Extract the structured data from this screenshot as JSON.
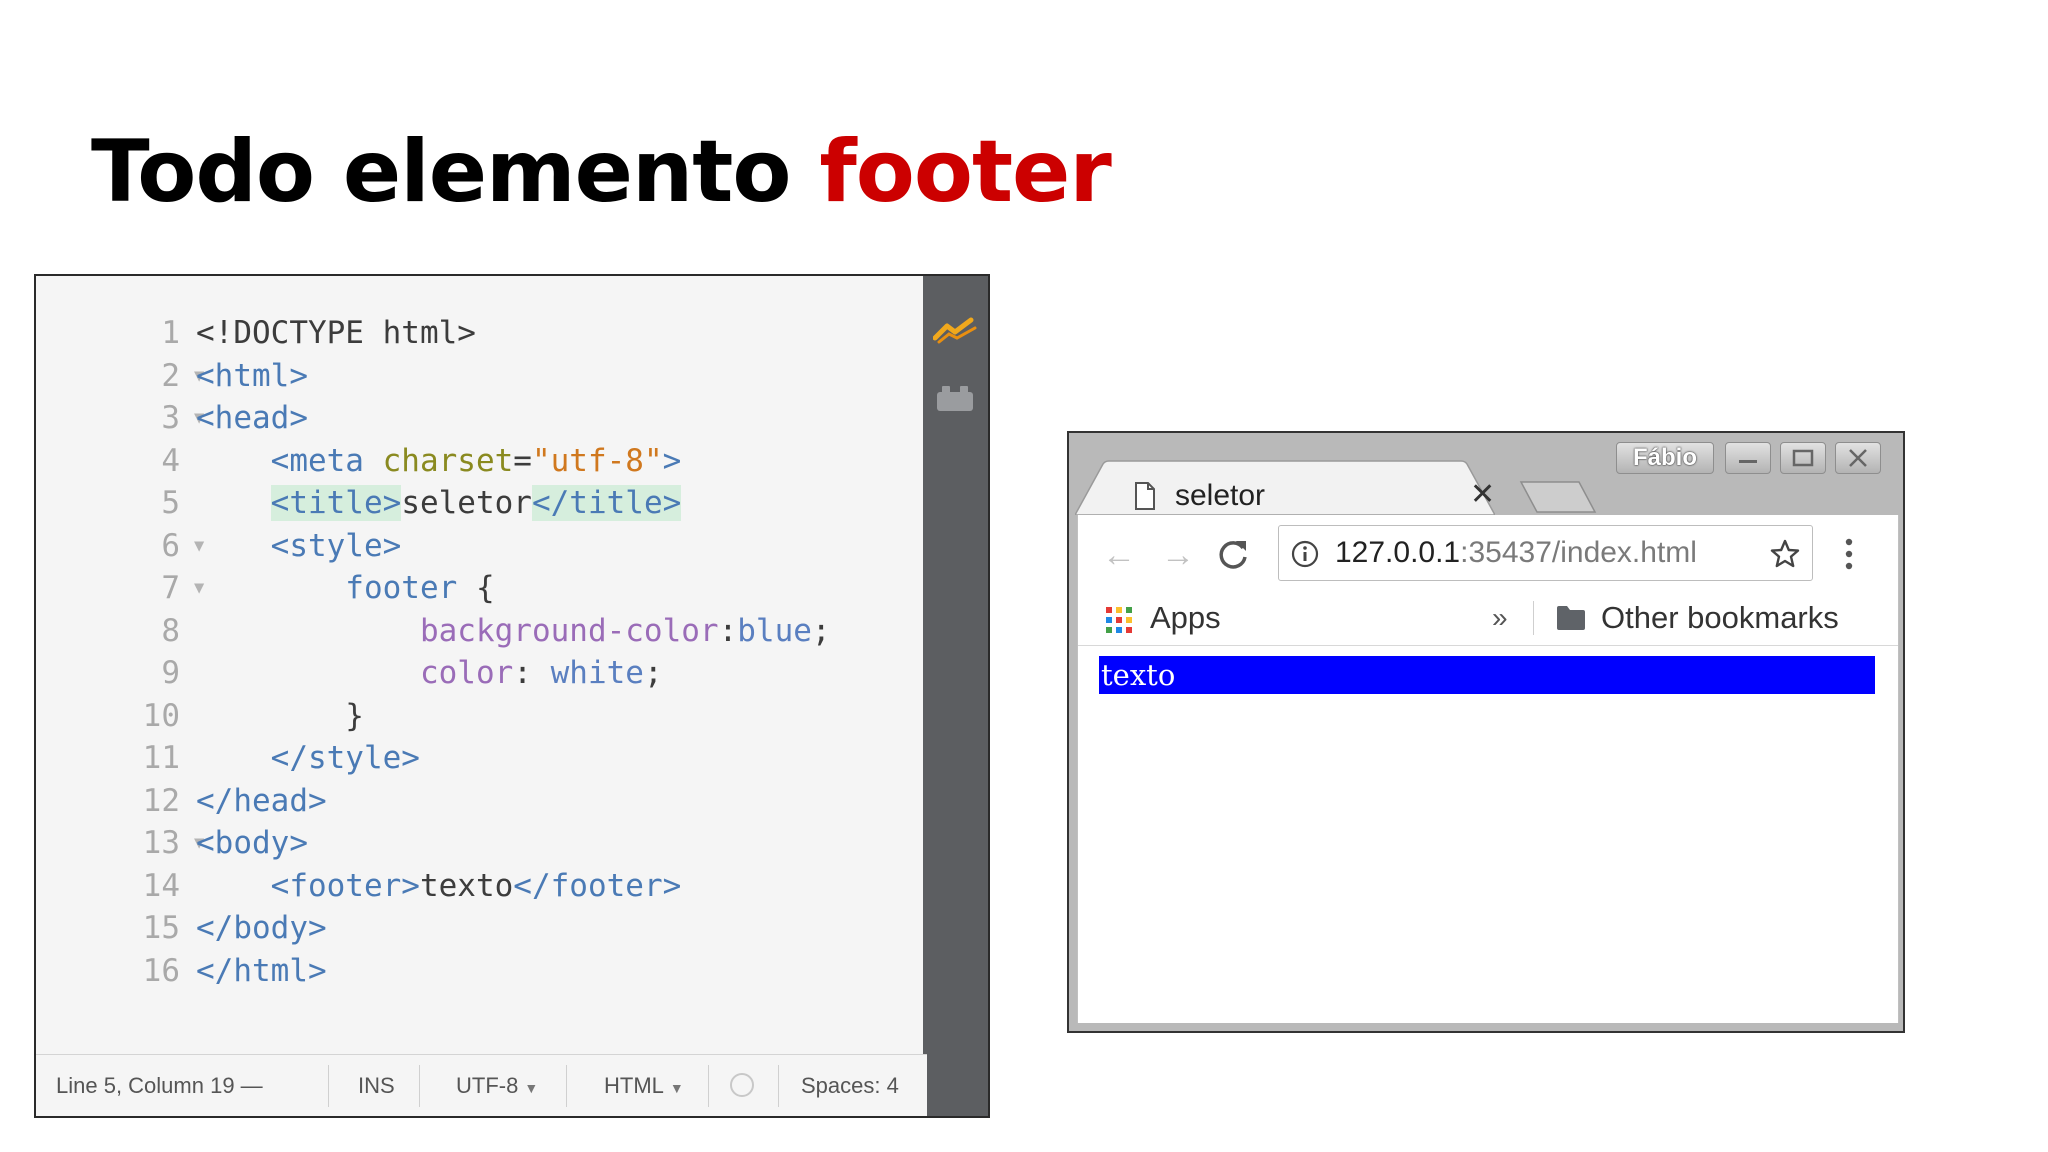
{
  "slide": {
    "title_prefix": "Todo elemento",
    "title_highlight": "footer"
  },
  "colors": {
    "title_accent": "#cc0000",
    "footer_background": "#0000ff",
    "footer_text": "#ffffff"
  },
  "editor": {
    "lines": [
      {
        "number": "1",
        "foldable": false,
        "tokens": [
          {
            "c": "txt",
            "t": "<!DOCTYPE html>"
          }
        ]
      },
      {
        "number": "2",
        "foldable": true,
        "tokens": [
          {
            "c": "t",
            "t": "<html>"
          }
        ]
      },
      {
        "number": "3",
        "foldable": true,
        "tokens": [
          {
            "c": "t",
            "t": "<head>"
          }
        ]
      },
      {
        "number": "4",
        "foldable": false,
        "tokens": [
          {
            "c": "t",
            "t": "    <meta "
          },
          {
            "c": "a",
            "t": "charset"
          },
          {
            "c": "txt",
            "t": "="
          },
          {
            "c": "s",
            "t": "\"utf-8\""
          },
          {
            "c": "t",
            "t": ">"
          }
        ]
      },
      {
        "number": "5",
        "foldable": false,
        "tokens": [
          {
            "c": "txt",
            "t": "    "
          },
          {
            "c": "t hl",
            "t": "<title>"
          },
          {
            "c": "txt",
            "t": "seletor"
          },
          {
            "c": "t hl",
            "t": "</title>"
          }
        ]
      },
      {
        "number": "6",
        "foldable": true,
        "tokens": [
          {
            "c": "t",
            "t": "    <style>"
          }
        ]
      },
      {
        "number": "7",
        "foldable": true,
        "tokens": [
          {
            "c": "t",
            "t": "        footer "
          },
          {
            "c": "txt",
            "t": "{"
          }
        ]
      },
      {
        "number": "8",
        "foldable": false,
        "tokens": [
          {
            "c": "txt",
            "t": "            "
          },
          {
            "c": "p",
            "t": "background-color"
          },
          {
            "c": "txt",
            "t": ":"
          },
          {
            "c": "v",
            "t": "blue"
          },
          {
            "c": "txt",
            "t": ";"
          }
        ]
      },
      {
        "number": "9",
        "foldable": false,
        "tokens": [
          {
            "c": "txt",
            "t": "            "
          },
          {
            "c": "p",
            "t": "color"
          },
          {
            "c": "txt",
            "t": ": "
          },
          {
            "c": "v",
            "t": "white"
          },
          {
            "c": "txt",
            "t": ";"
          }
        ]
      },
      {
        "number": "10",
        "foldable": false,
        "tokens": [
          {
            "c": "txt",
            "t": "        }"
          }
        ]
      },
      {
        "number": "11",
        "foldable": false,
        "tokens": [
          {
            "c": "t",
            "t": "    </style>"
          }
        ]
      },
      {
        "number": "12",
        "foldable": false,
        "tokens": [
          {
            "c": "t",
            "t": "</head>"
          }
        ]
      },
      {
        "number": "13",
        "foldable": true,
        "tokens": [
          {
            "c": "t",
            "t": "<body>"
          }
        ]
      },
      {
        "number": "14",
        "foldable": false,
        "tokens": [
          {
            "c": "t",
            "t": "    <footer>"
          },
          {
            "c": "txt",
            "t": "texto"
          },
          {
            "c": "t",
            "t": "</footer>"
          }
        ]
      },
      {
        "number": "15",
        "foldable": false,
        "tokens": [
          {
            "c": "t",
            "t": "</body>"
          }
        ]
      },
      {
        "number": "16",
        "foldable": false,
        "tokens": [
          {
            "c": "t",
            "t": "</html>"
          }
        ]
      }
    ],
    "sidebar_icons": [
      "live-preview-icon",
      "extension-manager-icon"
    ],
    "status": {
      "cursor": "Line 5, Column 19 —",
      "mode": "INS",
      "encoding": "UTF-8",
      "language": "HTML",
      "spaces": "Spaces:  4"
    }
  },
  "browser": {
    "profile": "Fábio",
    "tab_title": "seletor",
    "url_host": "127.0.0.1",
    "url_rest": ":35437/index.html",
    "bookmarks": {
      "apps": "Apps",
      "more": "»",
      "other": "Other bookmarks"
    },
    "content_text": "texto"
  }
}
